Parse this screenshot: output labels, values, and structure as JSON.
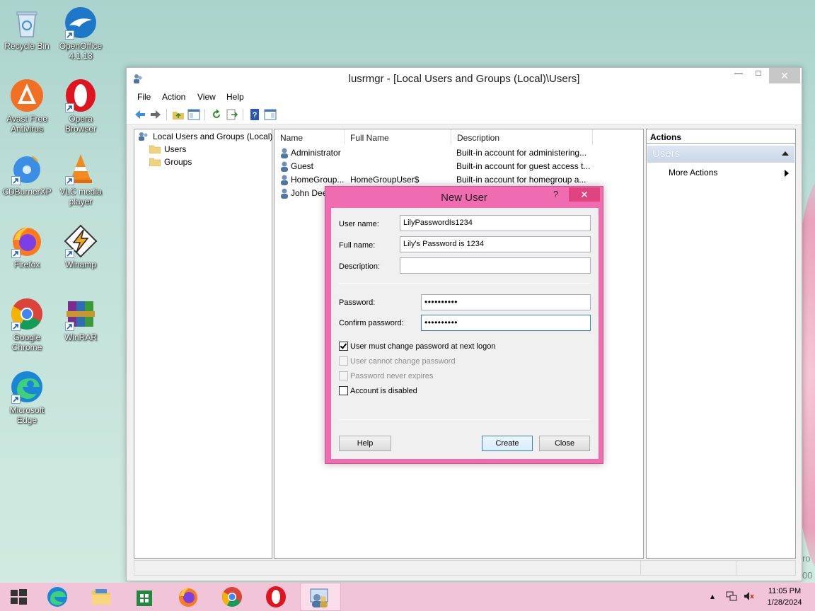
{
  "desktop": {
    "icons": [
      {
        "label": "Recycle Bin"
      },
      {
        "label": "OpenOffice 4.1.13"
      },
      {
        "label": "Avast Free Antivirus"
      },
      {
        "label": "Opera Browser"
      },
      {
        "label": "CDBurnerXP"
      },
      {
        "label": "VLC media player"
      },
      {
        "label": "Firefox"
      },
      {
        "label": "Winamp"
      },
      {
        "label": "Google Chrome"
      },
      {
        "label": "WinRAR"
      },
      {
        "label": "Microsoft Edge"
      }
    ],
    "watermark": [
      "ro",
      "00"
    ]
  },
  "window": {
    "title": "lusrmgr - [Local Users and Groups (Local)\\Users]",
    "menu": [
      "File",
      "Action",
      "View",
      "Help"
    ],
    "tree": {
      "root": "Local Users and Groups (Local)",
      "items": [
        "Users",
        "Groups"
      ]
    },
    "list": {
      "columns": [
        "Name",
        "Full Name",
        "Description"
      ],
      "rows": [
        {
          "name": "Administrator",
          "full_name": "",
          "description": "Built-in account for administering..."
        },
        {
          "name": "Guest",
          "full_name": "",
          "description": "Built-in account for guest access t..."
        },
        {
          "name": "HomeGroup...",
          "full_name": "HomeGroupUser$",
          "description": "Built-in account for homegroup a..."
        },
        {
          "name": "John Dee",
          "full_name": "",
          "description": ""
        }
      ]
    },
    "actions": {
      "header": "Actions",
      "section": "Users",
      "item": "More Actions"
    }
  },
  "dialog": {
    "title": "New User",
    "help_glyph": "?",
    "fields": {
      "user_name_label": "User name:",
      "user_name_value": "LilyPasswordIs1234",
      "full_name_label": "Full name:",
      "full_name_value": "Lily's Password is 1234",
      "description_label": "Description:",
      "description_value": "",
      "password_label": "Password:",
      "password_value": "••••••••••",
      "confirm_label": "Confirm password:",
      "confirm_value": "••••••••••"
    },
    "checkboxes": [
      {
        "label": "User must change password at next logon",
        "checked": true,
        "enabled": true
      },
      {
        "label": "User cannot change password",
        "checked": false,
        "enabled": false
      },
      {
        "label": "Password never expires",
        "checked": false,
        "enabled": false
      },
      {
        "label": "Account is disabled",
        "checked": false,
        "enabled": true
      }
    ],
    "buttons": {
      "help": "Help",
      "create": "Create",
      "close": "Close"
    }
  },
  "taskbar": {
    "apps": [
      "start",
      "edge",
      "file-explorer",
      "store",
      "firefox",
      "chrome",
      "opera",
      "lusrmgr"
    ],
    "active_app": "lusrmgr",
    "time": "11:05 PM",
    "date": "1/28/2024"
  },
  "colors": {
    "dialog_frame": "#f06cb0",
    "taskbar": "#f2c4d7",
    "desktop": "#bfe0d8",
    "actions_section": "#c9d7e8"
  }
}
